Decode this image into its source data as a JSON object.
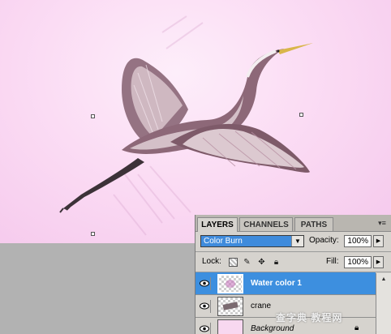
{
  "panel": {
    "tabs": [
      {
        "label": "LAYERS",
        "active": true
      },
      {
        "label": "CHANNELS",
        "active": false
      },
      {
        "label": "PATHS",
        "active": false
      }
    ],
    "blend_mode": "Color Burn",
    "opacity_label": "Opacity:",
    "opacity_value": "100%",
    "lock_label": "Lock:",
    "fill_label": "Fill:",
    "fill_value": "100%",
    "layers": [
      {
        "name": "Water color 1",
        "selected": true,
        "visible": true
      },
      {
        "name": "crane",
        "selected": false,
        "visible": true
      },
      {
        "name": "Background",
        "selected": false,
        "visible": true,
        "locked": true
      }
    ]
  },
  "watermark": "查字典 教程网",
  "colors": {
    "canvas_bg": "#fbdcf4",
    "selection_blue": "#3d8fdf",
    "panel_bg": "#d6d3ce"
  }
}
